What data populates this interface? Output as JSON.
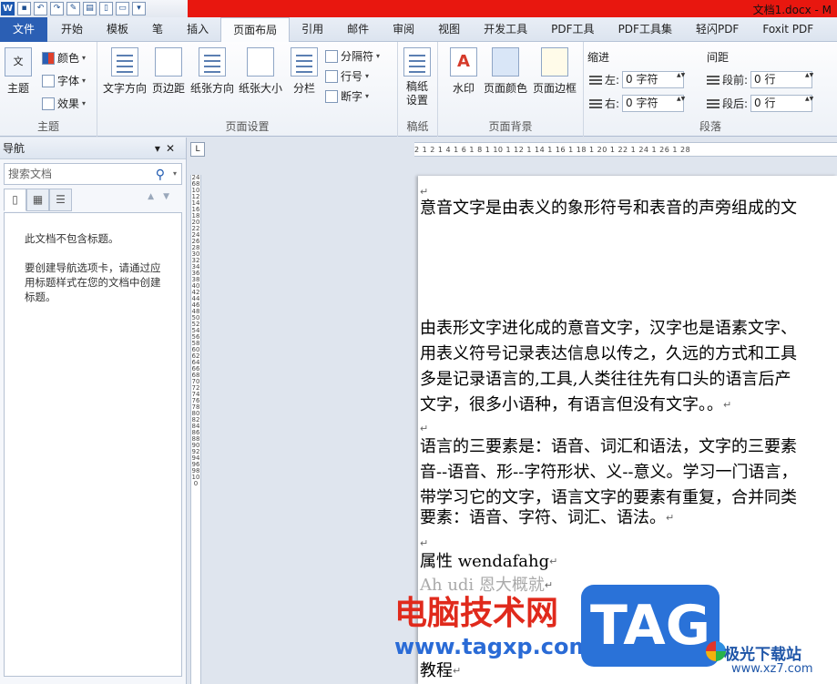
{
  "titlebar": {
    "doc_title": "文档1.docx - M"
  },
  "tabs": [
    "文件",
    "开始",
    "模板",
    "笔",
    "插入",
    "页面布局",
    "引用",
    "邮件",
    "审阅",
    "视图",
    "开发工具",
    "PDF工具",
    "PDF工具集",
    "轻闪PDF",
    "Foxit PDF"
  ],
  "active_tab": "页面布局",
  "ribbon": {
    "theme": {
      "label": "主题",
      "btn": "主题",
      "color": "颜色",
      "font": "字体",
      "effect": "效果"
    },
    "page_setup": {
      "label": "页面设置",
      "text_direction": "文字方向",
      "margins": "页边距",
      "orientation": "纸张方向",
      "size": "纸张大小",
      "columns": "分栏",
      "breaks": "分隔符",
      "line_numbers": "行号",
      "hyphenation": "断字"
    },
    "draft": {
      "label": "稿纸",
      "btn": "稿纸\n设置"
    },
    "page_bg": {
      "label": "页面背景",
      "watermark": "水印",
      "page_color": "页面颜色",
      "page_borders": "页面边框"
    },
    "paragraph": {
      "label": "段落",
      "indent": "缩进",
      "spacing": "间距",
      "left": "左:",
      "right": "右:",
      "before": "段前:",
      "after": "段后:",
      "left_val": "0 字符",
      "right_val": "0 字符",
      "before_val": "0 行",
      "after_val": "0 行"
    }
  },
  "nav": {
    "title": "导航",
    "search_placeholder": "搜索文档",
    "msg1": "此文档不包含标题。",
    "msg2": "要创建导航选项卡，请通过应用标题样式在您的文档中创建标题。"
  },
  "ruler": {
    "h": "2 1 2 1 4 1 6 1 8 1 10 1 12 1 14 1 16 1 18 1 20 1 22 1 24 1 26 1 28",
    "v": "2468101214161820222426283032343638404244464850525456586062646668707274767880828486889092949698100"
  },
  "document": {
    "lines": [
      "意音文字是由表义的象形符号和表音的声旁组成的文",
      "由表形文字进化成的意音文字，汉字也是语素文字、",
      "用表义符号记录表达信息以传之，久远的方式和工具",
      "多是记录语言的,工具,人类往往先有口头的语言后产",
      "文字，很多小语种，有语言但没有文字。。",
      "语言的三要素是：语音、词汇和语法，文字的三要素",
      "音--语音、形--字符形状、义--意义。学习一门语言，",
      "带学习它的文字，语言文字的要素有重复，合并同类",
      "要素：语音、字符、词汇、语法。",
      "属性  wendafahg",
      "Ah udi  恩大概就",
      "教程"
    ],
    "para_mark": "↵"
  },
  "watermark": {
    "text": "电脑技术网",
    "url": "www.tagxp.com",
    "tag": "TAG",
    "site_cn": "极光下载站",
    "site_en": "www.xz7.com"
  }
}
